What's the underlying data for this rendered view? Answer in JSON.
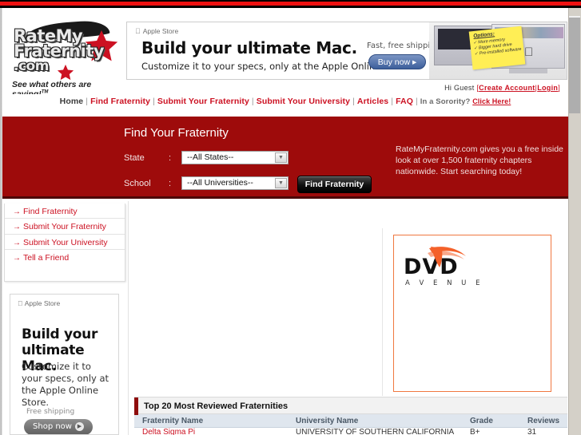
{
  "site": {
    "logo_line1": "RateMy",
    "logo_line2": "Fraternity",
    "logo_line3": ".com",
    "tagline": "See what others are saying!",
    "tagline_sup": "TM"
  },
  "banner_ad": {
    "store_label": "Apple Store",
    "headline": "Build your ultimate Mac.",
    "subline": "Customize it to your specs, only at the Apple Online Store.",
    "shipping": "Fast, free shipping.",
    "cta": "Buy now ▸",
    "note_title": "Options:",
    "note_items": [
      "✓ More memory",
      "✓ Bigger hard drive",
      "✓ Pre-installed software"
    ]
  },
  "greeting": {
    "hello": "Hi Guest",
    "open_bracket": "[",
    "create_account": "Create Account",
    "pipe": "|",
    "login": "Login",
    "close_bracket": "]"
  },
  "nav": {
    "home": "Home",
    "find_fraternity": "Find Fraternity",
    "submit_fraternity": "Submit Your Fraternity",
    "submit_university": "Submit Your University",
    "articles": "Articles",
    "faq": "FAQ",
    "sorority_text": "In a Sorority?",
    "sorority_link": "Click Here!",
    "separator": "|"
  },
  "hero": {
    "title": "Find Your Fraternity",
    "state_label": "State",
    "school_label": "School",
    "colon": ":",
    "state_value": "--All States--",
    "school_value": "--All Universities--",
    "submit_label": "Find Fraternity",
    "blurb": "RateMyFraternity.com gives you a free inside look at over 1,500 fraternity chapters nationwide. Start searching today!",
    "accent_color": "#9e0b0b"
  },
  "sidebar": {
    "items": [
      {
        "label": "Find Fraternity",
        "arrow": "→"
      },
      {
        "label": "Submit Your Fraternity",
        "arrow": "→"
      },
      {
        "label": "Submit Your University",
        "arrow": "→"
      },
      {
        "label": "Tell a Friend",
        "arrow": "→"
      }
    ]
  },
  "sidebar_ad": {
    "store_label": "Apple Store",
    "headline_l1": "Build your",
    "headline_l2": "ultimate Mac.",
    "subline": "Customize it to your specs, only at the Apple Online Store.",
    "shipping": "Free shipping",
    "cta": "Shop now"
  },
  "dvd_ad": {
    "word": "DVD",
    "subword": "A V E N U E",
    "border_color": "#f07840",
    "swoosh_color": "#f4612a"
  },
  "table": {
    "title": "Top 20 Most Reviewed Fraternities",
    "columns": [
      "Fraternity Name",
      "University Name",
      "Grade",
      "Reviews"
    ],
    "rows": [
      {
        "fraternity": "Delta Sigma Pi",
        "university": "UNIVERSITY OF SOUTHERN CALIFORNIA",
        "grade": "B+",
        "reviews": "31"
      }
    ]
  }
}
